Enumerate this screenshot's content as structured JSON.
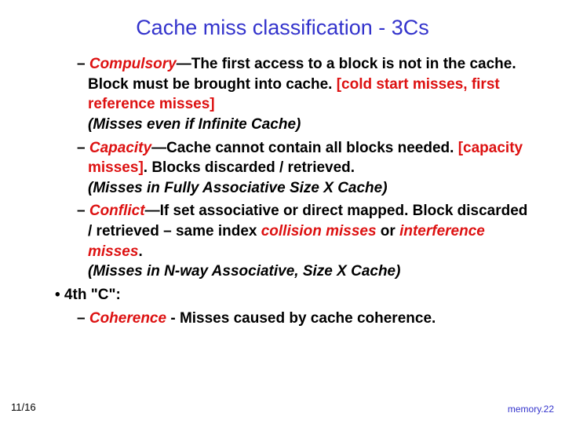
{
  "title": "Cache miss classification - 3Cs",
  "items": {
    "c1": {
      "dash": "– ",
      "name": "Compulsory",
      "after": "—The first access to a block is not in the cache. Block must be brought into cache. ",
      "bracket": "[cold start misses, first reference misses]",
      "paren": "(Misses even if Infinite Cache)"
    },
    "c2": {
      "dash": "– ",
      "name": "Capacity",
      "after": "—Cache cannot contain all blocks needed. ",
      "bracket": "[capacity misses]",
      "afterBracket": ". Blocks discarded / retrieved.",
      "paren": "(Misses in Fully Associative Size X Cache)"
    },
    "c3": {
      "dash": "– ",
      "name": "Conflict",
      "after": "—If set associative or direct mapped. Block discarded / retrieved – same index ",
      "r1": "collision misses",
      "mid": " or ",
      "r2": "interference misses",
      "period": ".",
      "paren": "(Misses in N-way Associative, Size X Cache)"
    },
    "fourth": {
      "bullet": "• 4th \"C\":",
      "dash": "– ",
      "name": "Coherence",
      "after": " - Misses caused by cache coherence."
    }
  },
  "footer": {
    "left": "11/16",
    "right": "memory.22"
  }
}
